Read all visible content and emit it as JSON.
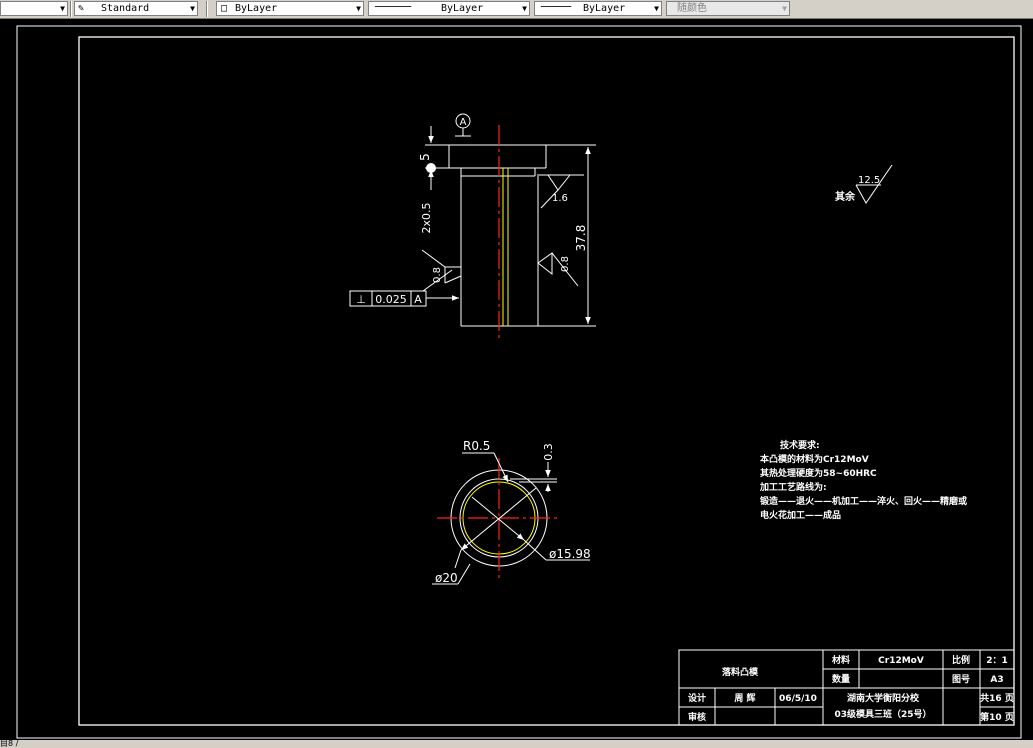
{
  "toolbar": {
    "text_style": "Standard",
    "layer": "ByLayer",
    "linetype": "ByLayer",
    "lineweight": "ByLayer",
    "color": "随颜色"
  },
  "drawing": {
    "datum_label": "A",
    "dim_5": "5",
    "dim_2x05": "2x0.5",
    "dim_37_8": "37.8",
    "rough_16": "1.6",
    "rough_08_left": "0.8",
    "rough_08_right": "0.8",
    "tol_symbol": "⊥",
    "tol_value": "0.025",
    "tol_datum": "A",
    "rough_rest_value": "12.5",
    "rough_rest_label": "其余",
    "r05": "R0.5",
    "dim_03": "0.3",
    "d1598": "ø15.98",
    "d20": "ø20"
  },
  "tech": {
    "title": "技术要求:",
    "l1": "本凸模的材料为Cr12MoV",
    "l2": "其热处理硬度为58~60HRC",
    "l3": "加工工艺路线为:",
    "l4": "锻造——退火——机加工——淬火、回火——精磨或",
    "l5": "电火花加工——成品"
  },
  "titleblock": {
    "part_name": "落料凸模",
    "material_label": "材料",
    "material": "Cr12MoV",
    "scale_label": "比例",
    "scale": "2：1",
    "qty_label": "数量",
    "drawno_label": "图号",
    "drawno": "A3",
    "design_label": "设计",
    "designer": "周  辉",
    "date": "06/5/10",
    "school": "湖南大学衡阳分校",
    "class": "03级模具三班（25号）",
    "sheets": "共16 页",
    "sheet_no": "第10 页",
    "review_label": "审核"
  },
  "status": "目8 /"
}
